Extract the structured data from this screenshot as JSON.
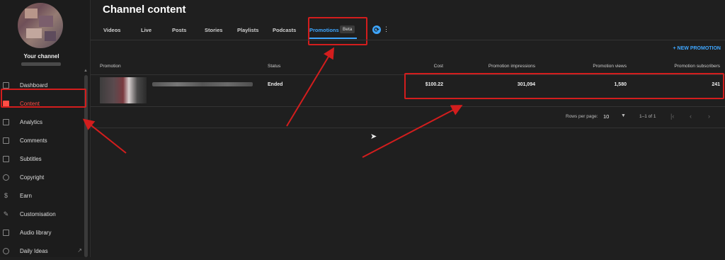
{
  "sidebar": {
    "channel_name": "Your channel",
    "items": [
      {
        "label": "Dashboard",
        "icon": "dashboard-icon"
      },
      {
        "label": "Content",
        "icon": "content-icon",
        "active": true
      },
      {
        "label": "Analytics",
        "icon": "analytics-icon"
      },
      {
        "label": "Comments",
        "icon": "comments-icon"
      },
      {
        "label": "Subtitles",
        "icon": "subtitles-icon"
      },
      {
        "label": "Copyright",
        "icon": "copyright-icon"
      },
      {
        "label": "Earn",
        "icon": "earn-icon"
      },
      {
        "label": "Customisation",
        "icon": "customisation-icon"
      },
      {
        "label": "Audio library",
        "icon": "audio-library-icon"
      },
      {
        "label": "Daily Ideas",
        "icon": "daily-ideas-icon"
      }
    ]
  },
  "header": {
    "title": "Channel content"
  },
  "tabs": [
    {
      "label": "Videos"
    },
    {
      "label": "Live"
    },
    {
      "label": "Posts"
    },
    {
      "label": "Stories"
    },
    {
      "label": "Playlists"
    },
    {
      "label": "Podcasts"
    },
    {
      "label": "Promotions",
      "active": true
    }
  ],
  "beta_label": "Beta",
  "new_promotion_label": "+ NEW PROMOTION",
  "table": {
    "columns": [
      "Promotion",
      "Status",
      "Cost",
      "Promotion impressions",
      "Promotion views",
      "Promotion subscribers"
    ],
    "rows": [
      {
        "status": "Ended",
        "cost": "$100.22",
        "impressions": "301,094",
        "views": "1,580",
        "subscribers": "241"
      }
    ]
  },
  "pagination": {
    "rows_per_page_label": "Rows per page:",
    "rows_per_page_value": "10",
    "range": "1–1 of 1"
  },
  "colors": {
    "accent_blue": "#3ea6ff",
    "active_red": "#ff4e45",
    "annotation_red": "#d31d1d",
    "background": "#1f1f1f"
  }
}
